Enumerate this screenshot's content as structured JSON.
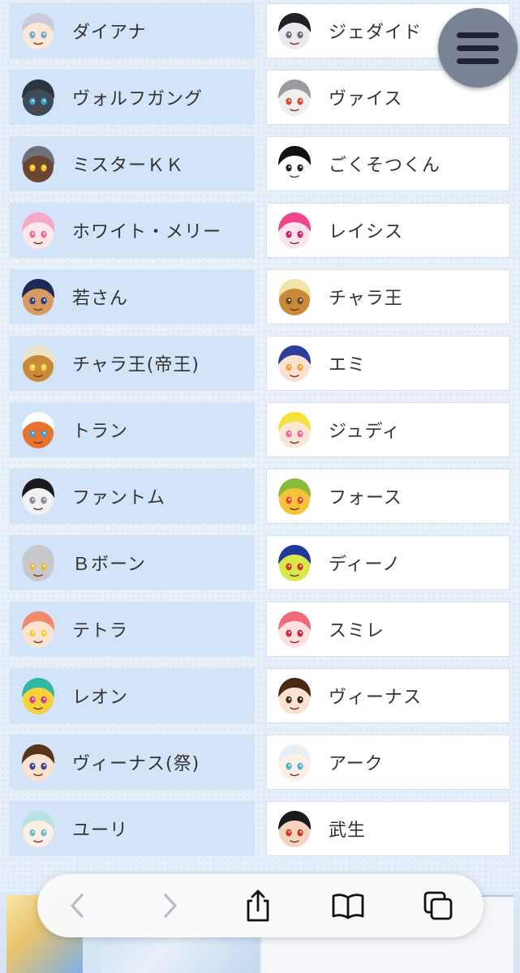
{
  "characters": {
    "left": [
      {
        "name": "ダイアナ",
        "icon": "diana-avatar-icon",
        "palette": {
          "hair": "#c9ccd8",
          "skin": "#fde7d8",
          "accent": "#7aa8c8"
        }
      },
      {
        "name": "ヴォルフガング",
        "icon": "wolfgang-avatar-icon",
        "palette": {
          "hair": "#2c3440",
          "skin": "#3d4a58",
          "accent": "#3aa7d8"
        }
      },
      {
        "name": "ミスターＫＫ",
        "icon": "mister-kk-avatar-icon",
        "palette": {
          "hair": "#6e7178",
          "skin": "#6a4632",
          "accent": "#f2c21a"
        }
      },
      {
        "name": "ホワイト・メリー",
        "icon": "white-merry-avatar-icon",
        "palette": {
          "hair": "#f5a8c8",
          "skin": "#fde9ea",
          "accent": "#f06aa0"
        }
      },
      {
        "name": "若さん",
        "icon": "waka-san-avatar-icon",
        "palette": {
          "hair": "#1d2a55",
          "skin": "#d99a62",
          "accent": "#2a3f8a"
        }
      },
      {
        "name": "チャラ王(帝王)",
        "icon": "chara-ou-teiou-avatar-icon",
        "palette": {
          "hair": "#e9e6c8",
          "skin": "#c98a3a",
          "accent": "#f2d23a"
        }
      },
      {
        "name": "トラン",
        "icon": "toran-avatar-icon",
        "palette": {
          "hair": "#ffffff",
          "skin": "#e8732e",
          "accent": "#3d9bd8"
        }
      },
      {
        "name": "ファントム",
        "icon": "phantom-avatar-icon",
        "palette": {
          "hair": "#1b1b1f",
          "skin": "#f1f1f3",
          "accent": "#8a8a92"
        }
      },
      {
        "name": "Ｂボーン",
        "icon": "b-bone-avatar-icon",
        "palette": {
          "hair": "#c8c8cc",
          "skin": "#c8c8cc",
          "accent": "#f0b830"
        }
      },
      {
        "name": "テトラ",
        "icon": "tetra-avatar-icon",
        "palette": {
          "hair": "#f08a6a",
          "skin": "#fbe3d3",
          "accent": "#f5d23a"
        }
      },
      {
        "name": "レオン",
        "icon": "leon-avatar-icon",
        "palette": {
          "hair": "#2fb8a8",
          "skin": "#f8d23a",
          "accent": "#d83a8a"
        }
      },
      {
        "name": "ヴィーナス(祭)",
        "icon": "venus-matsuri-avatar-icon",
        "palette": {
          "hair": "#5a3418",
          "skin": "#fbe2d0",
          "accent": "#3a4a9a"
        }
      },
      {
        "name": "ユーリ",
        "icon": "yuri-avatar-icon",
        "palette": {
          "hair": "#b8e3e0",
          "skin": "#fdeee6",
          "accent": "#6ac2c0"
        }
      }
    ],
    "right": [
      {
        "name": "ジェダイド",
        "icon": "jedaido-avatar-icon",
        "palette": {
          "hair": "#1f2126",
          "skin": "#eceaf0",
          "accent": "#6d6e78"
        }
      },
      {
        "name": "ヴァイス",
        "icon": "vice-avatar-icon",
        "palette": {
          "hair": "#9a9aa2",
          "skin": "#efeff2",
          "accent": "#e04a2a"
        }
      },
      {
        "name": "ごくそつくん",
        "icon": "gokusotsu-kun-avatar-icon",
        "palette": {
          "hair": "#111111",
          "skin": "#ffffff",
          "accent": "#222222"
        }
      },
      {
        "name": "レイシス",
        "icon": "rasis-avatar-icon",
        "palette": {
          "hair": "#f0458a",
          "skin": "#fde4ec",
          "accent": "#d81f6a"
        }
      },
      {
        "name": "チャラ王",
        "icon": "chara-ou-avatar-icon",
        "palette": {
          "hair": "#efe5a8",
          "skin": "#c98a3a",
          "accent": "#6a4a2a"
        }
      },
      {
        "name": "エミ",
        "icon": "emi-avatar-icon",
        "palette": {
          "hair": "#2c3d9c",
          "skin": "#fbe1cf",
          "accent": "#f0a63a"
        }
      },
      {
        "name": "ジュディ",
        "icon": "judy-avatar-icon",
        "palette": {
          "hair": "#f6e23a",
          "skin": "#fbe6d6",
          "accent": "#f06aa0"
        }
      },
      {
        "name": "フォース",
        "icon": "force-avatar-icon",
        "palette": {
          "hair": "#8aba3a",
          "skin": "#f6c23a",
          "accent": "#e04a3a"
        }
      },
      {
        "name": "ディーノ",
        "icon": "dino-avatar-icon",
        "palette": {
          "hair": "#1f3a9a",
          "skin": "#d8e84a",
          "accent": "#e0301f"
        }
      },
      {
        "name": "スミレ",
        "icon": "sumire-avatar-icon",
        "palette": {
          "hair": "#ef6a7a",
          "skin": "#fde0e0",
          "accent": "#d8243a"
        }
      },
      {
        "name": "ヴィーナス",
        "icon": "venus-avatar-icon",
        "palette": {
          "hair": "#4a2a12",
          "skin": "#fbe2d0",
          "accent": "#3a2a1a"
        }
      },
      {
        "name": "アーク",
        "icon": "ark-avatar-icon",
        "palette": {
          "hair": "#e8eef2",
          "skin": "#fdf0ea",
          "accent": "#4ab8c8"
        }
      },
      {
        "name": "武生",
        "icon": "takeo-avatar-icon",
        "palette": {
          "hair": "#1a1a1a",
          "skin": "#f3d4c0",
          "accent": "#e0301f"
        }
      }
    ]
  },
  "menu": {
    "icon": "hamburger-menu-icon"
  },
  "toolbar": {
    "buttons": [
      {
        "icon": "back-chevron-icon",
        "enabled": false
      },
      {
        "icon": "forward-chevron-icon",
        "enabled": false
      },
      {
        "icon": "share-icon",
        "enabled": true
      },
      {
        "icon": "bookmarks-icon",
        "enabled": true
      },
      {
        "icon": "tabs-icon",
        "enabled": true
      }
    ]
  },
  "colors": {
    "left_cell_bg": "#d3e3f8",
    "right_cell_bg": "#ffffff",
    "text": "#333333",
    "menu_button": "#7a8396"
  }
}
